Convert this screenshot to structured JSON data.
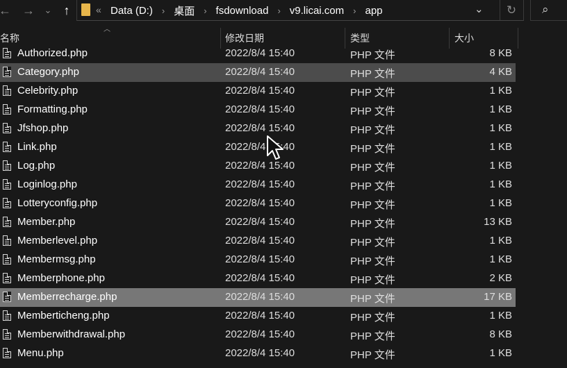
{
  "address_bar": {
    "prefix": "«",
    "crumbs": [
      "Data (D:)",
      "桌面",
      "fsdownload",
      "v9.licai.com",
      "app"
    ],
    "separator": "›"
  },
  "columns": {
    "name": "名称",
    "date": "修改日期",
    "type": "类型",
    "size": "大小"
  },
  "files": [
    {
      "name": "Authorized.php",
      "date": "2022/8/4 15:40",
      "type": "PHP 文件",
      "size": "8 KB"
    },
    {
      "name": "Category.php",
      "date": "2022/8/4 15:40",
      "type": "PHP 文件",
      "size": "4 KB"
    },
    {
      "name": "Celebrity.php",
      "date": "2022/8/4 15:40",
      "type": "PHP 文件",
      "size": "1 KB"
    },
    {
      "name": "Formatting.php",
      "date": "2022/8/4 15:40",
      "type": "PHP 文件",
      "size": "1 KB"
    },
    {
      "name": "Jfshop.php",
      "date": "2022/8/4 15:40",
      "type": "PHP 文件",
      "size": "1 KB"
    },
    {
      "name": "Link.php",
      "date": "2022/8/4 15:40",
      "type": "PHP 文件",
      "size": "1 KB"
    },
    {
      "name": "Log.php",
      "date": "2022/8/4 15:40",
      "type": "PHP 文件",
      "size": "1 KB"
    },
    {
      "name": "Loginlog.php",
      "date": "2022/8/4 15:40",
      "type": "PHP 文件",
      "size": "1 KB"
    },
    {
      "name": "Lotteryconfig.php",
      "date": "2022/8/4 15:40",
      "type": "PHP 文件",
      "size": "1 KB"
    },
    {
      "name": "Member.php",
      "date": "2022/8/4 15:40",
      "type": "PHP 文件",
      "size": "13 KB"
    },
    {
      "name": "Memberlevel.php",
      "date": "2022/8/4 15:40",
      "type": "PHP 文件",
      "size": "1 KB"
    },
    {
      "name": "Membermsg.php",
      "date": "2022/8/4 15:40",
      "type": "PHP 文件",
      "size": "1 KB"
    },
    {
      "name": "Memberphone.php",
      "date": "2022/8/4 15:40",
      "type": "PHP 文件",
      "size": "2 KB"
    },
    {
      "name": "Memberrecharge.php",
      "date": "2022/8/4 15:40",
      "type": "PHP 文件",
      "size": "17 KB"
    },
    {
      "name": "Memberticheng.php",
      "date": "2022/8/4 15:40",
      "type": "PHP 文件",
      "size": "1 KB"
    },
    {
      "name": "Memberwithdrawal.php",
      "date": "2022/8/4 15:40",
      "type": "PHP 文件",
      "size": "8 KB"
    },
    {
      "name": "Menu.php",
      "date": "2022/8/4 15:40",
      "type": "PHP 文件",
      "size": "1 KB"
    }
  ],
  "selected_rows": [
    "Category.php"
  ],
  "hovered_rows": [
    "Memberrecharge.php"
  ],
  "colors": {
    "background": "#191919",
    "selected_row": "#4c4c4c",
    "hovered_row": "#777777",
    "folder": "#e8b64b"
  }
}
